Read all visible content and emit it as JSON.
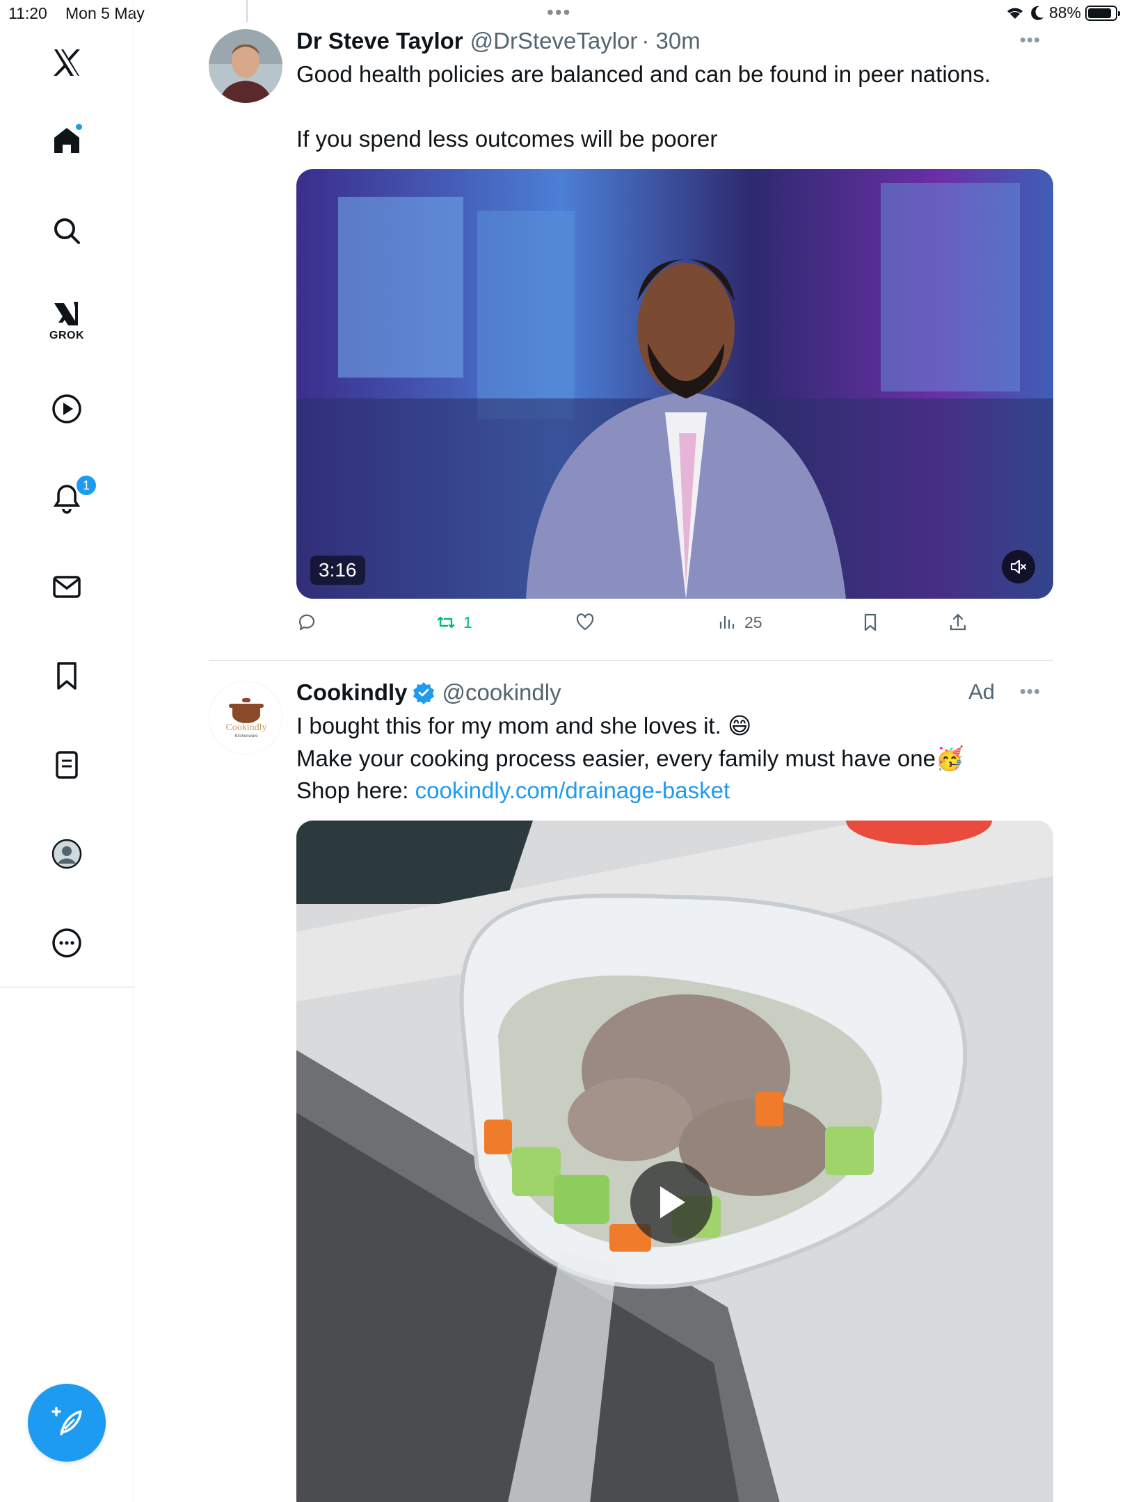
{
  "status_bar": {
    "time": "11:20",
    "date": "Mon 5 May",
    "battery": "88%",
    "battery_level": 0.88
  },
  "sidebar": {
    "grok_label": "GROK",
    "notifications_count": "1",
    "items": [
      {
        "name": "x-logo"
      },
      {
        "name": "home"
      },
      {
        "name": "search"
      },
      {
        "name": "grok"
      },
      {
        "name": "video"
      },
      {
        "name": "notifications"
      },
      {
        "name": "messages"
      },
      {
        "name": "bookmarks"
      },
      {
        "name": "lists"
      },
      {
        "name": "profile"
      },
      {
        "name": "more"
      }
    ]
  },
  "tweets": [
    {
      "name": "Dr Steve Taylor",
      "handle": "@DrSteveTaylor",
      "time": "· 30m",
      "text_line1": "Good health policies are balanced and can be found in peer nations.",
      "text_line2": "If you spend less outcomes will be poorer",
      "video_duration": "3:16",
      "retweets": "1",
      "views": "25"
    },
    {
      "name": "Cookindly",
      "handle": "@cookindly",
      "ad_label": "Ad",
      "avatar_text": "Cookindly",
      "avatar_subtext": "Kitchenware",
      "text_line1": "I bought this for my mom and she loves it. 😄",
      "text_line2": "Make your cooking process easier, every family must have one🥳",
      "text_line3_prefix": "Shop here: ",
      "link": "cookindly.com/drainage-basket"
    }
  ],
  "colors": {
    "accent": "#1d9bf0",
    "retweet": "#00ba7c",
    "muted": "#536471"
  }
}
